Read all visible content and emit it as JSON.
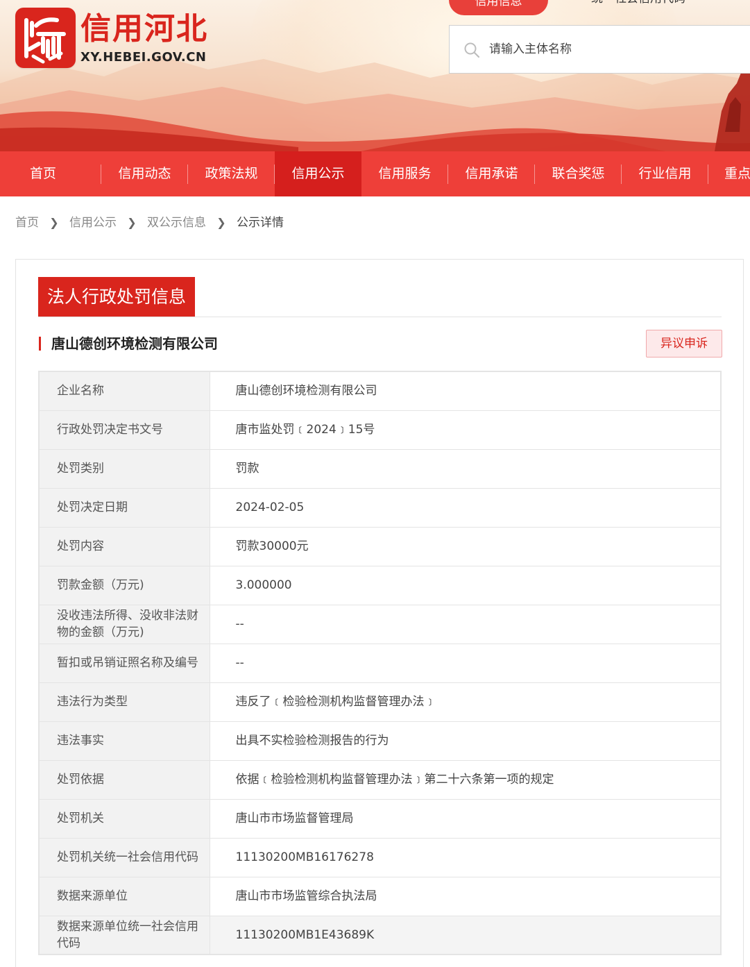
{
  "site": {
    "title": "信用河北",
    "url": "XY.HEBEI.GOV.CN"
  },
  "top": {
    "tab_label": "信用信息",
    "links_text": "统一社会信用代码"
  },
  "search": {
    "placeholder": "请输入主体名称"
  },
  "nav": {
    "items": [
      {
        "label": "首页"
      },
      {
        "label": "信用动态"
      },
      {
        "label": "政策法规"
      },
      {
        "label": "信用公示",
        "active": true
      },
      {
        "label": "信用服务"
      },
      {
        "label": "信用承诺"
      },
      {
        "label": "联合奖惩"
      },
      {
        "label": "行业信用"
      },
      {
        "label": "重点"
      }
    ]
  },
  "breadcrumb": {
    "items": [
      "首页",
      "信用公示",
      "双公示信息",
      "公示详情"
    ]
  },
  "section": {
    "title": "法人行政处罚信息",
    "company": "唐山德创环境检测有限公司",
    "appeal_label": "异议申诉"
  },
  "details": [
    {
      "label": "企业名称",
      "value": "唐山德创环境检测有限公司"
    },
    {
      "label": "行政处罚决定书文号",
      "value": "唐市监处罚﹝2024﹞15号"
    },
    {
      "label": "处罚类别",
      "value": "罚款"
    },
    {
      "label": "处罚决定日期",
      "value": "2024-02-05"
    },
    {
      "label": "处罚内容",
      "value": "罚款30000元"
    },
    {
      "label": "罚款金额（万元)",
      "value": "3.000000"
    },
    {
      "label": "没收违法所得、没收非法财物的金额（万元)",
      "value": "--"
    },
    {
      "label": "暂扣或吊销证照名称及编号",
      "value": "--"
    },
    {
      "label": "违法行为类型",
      "value": "违反了﹝检验检测机构监督管理办法﹞"
    },
    {
      "label": "违法事实",
      "value": "出具不实检验检测报告的行为"
    },
    {
      "label": "处罚依据",
      "value": "依据﹝检验检测机构监督管理办法﹞第二十六条第一项的规定"
    },
    {
      "label": "处罚机关",
      "value": "唐山市市场监督管理局"
    },
    {
      "label": "处罚机关统一社会信用代码",
      "value": "11130200MB16176278"
    },
    {
      "label": "数据来源单位",
      "value": "唐山市市场监管综合执法局"
    },
    {
      "label": "数据来源单位统一社会信用代码",
      "value": "11130200MB1E43689K"
    }
  ],
  "colors": {
    "brand_red": "#d9251d",
    "nav_red": "#ee3f39",
    "nav_active": "#d51f1d"
  }
}
